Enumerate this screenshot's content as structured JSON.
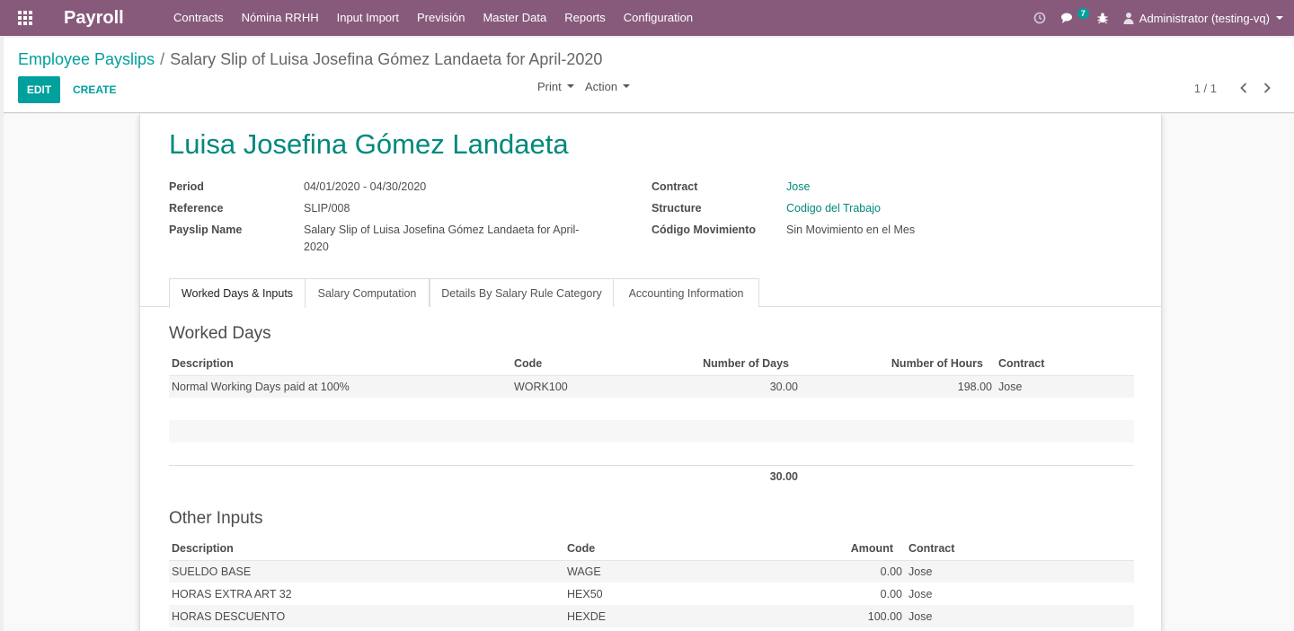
{
  "navbar": {
    "brand": "Payroll",
    "menu": [
      "Contracts",
      "Nómina RRHH",
      "Input Import",
      "Previsión",
      "Master Data",
      "Reports",
      "Configuration"
    ],
    "messages_count": "7",
    "user": "Administrator (testing-vq)"
  },
  "control_panel": {
    "breadcrumb_parent": "Employee Payslips",
    "breadcrumb_separator": "/",
    "breadcrumb_current": "Salary Slip of Luisa Josefina Gómez Landaeta for April-2020",
    "edit_label": "EDIT",
    "create_label": "CREATE",
    "print_label": "Print",
    "action_label": "Action",
    "pager": "1 / 1"
  },
  "form": {
    "employee_name": "Luisa Josefina Gómez Landaeta",
    "period_label": "Period",
    "period_value": "04/01/2020 - 04/30/2020",
    "reference_label": "Reference",
    "reference_value": "SLIP/008",
    "payslip_name_label": "Payslip Name",
    "payslip_name_value_line1": "Salary Slip of Luisa Josefina Gómez Landaeta for April-",
    "payslip_name_value_line2": "2020",
    "contract_label": "Contract",
    "contract_value": "Jose",
    "structure_label": "Structure",
    "structure_value": "Codigo del Trabajo",
    "movement_label": "Código Movimiento",
    "movement_value": "Sin Movimiento en el Mes"
  },
  "tabs": [
    "Worked Days & Inputs",
    "Salary Computation",
    "Details By Salary Rule Category",
    "Accounting Information"
  ],
  "worked_days": {
    "title": "Worked Days",
    "headers": {
      "description": "Description",
      "code": "Code",
      "days": "Number of Days",
      "hours": "Number of Hours",
      "contract": "Contract"
    },
    "rows": [
      {
        "description": "Normal Working Days paid at 100%",
        "code": "WORK100",
        "days": "30.00",
        "hours": "198.00",
        "contract": "Jose"
      }
    ],
    "total_days": "30.00"
  },
  "other_inputs": {
    "title": "Other Inputs",
    "headers": {
      "description": "Description",
      "code": "Code",
      "amount": "Amount",
      "contract": "Contract"
    },
    "rows": [
      {
        "description": "SUELDO BASE",
        "code": "WAGE",
        "amount": "0.00",
        "contract": "Jose"
      },
      {
        "description": "HORAS EXTRA ART 32",
        "code": "HEX50",
        "amount": "0.00",
        "contract": "Jose"
      },
      {
        "description": "HORAS DESCUENTO",
        "code": "HEXDE",
        "amount": "100.00",
        "contract": "Jose"
      }
    ]
  }
}
